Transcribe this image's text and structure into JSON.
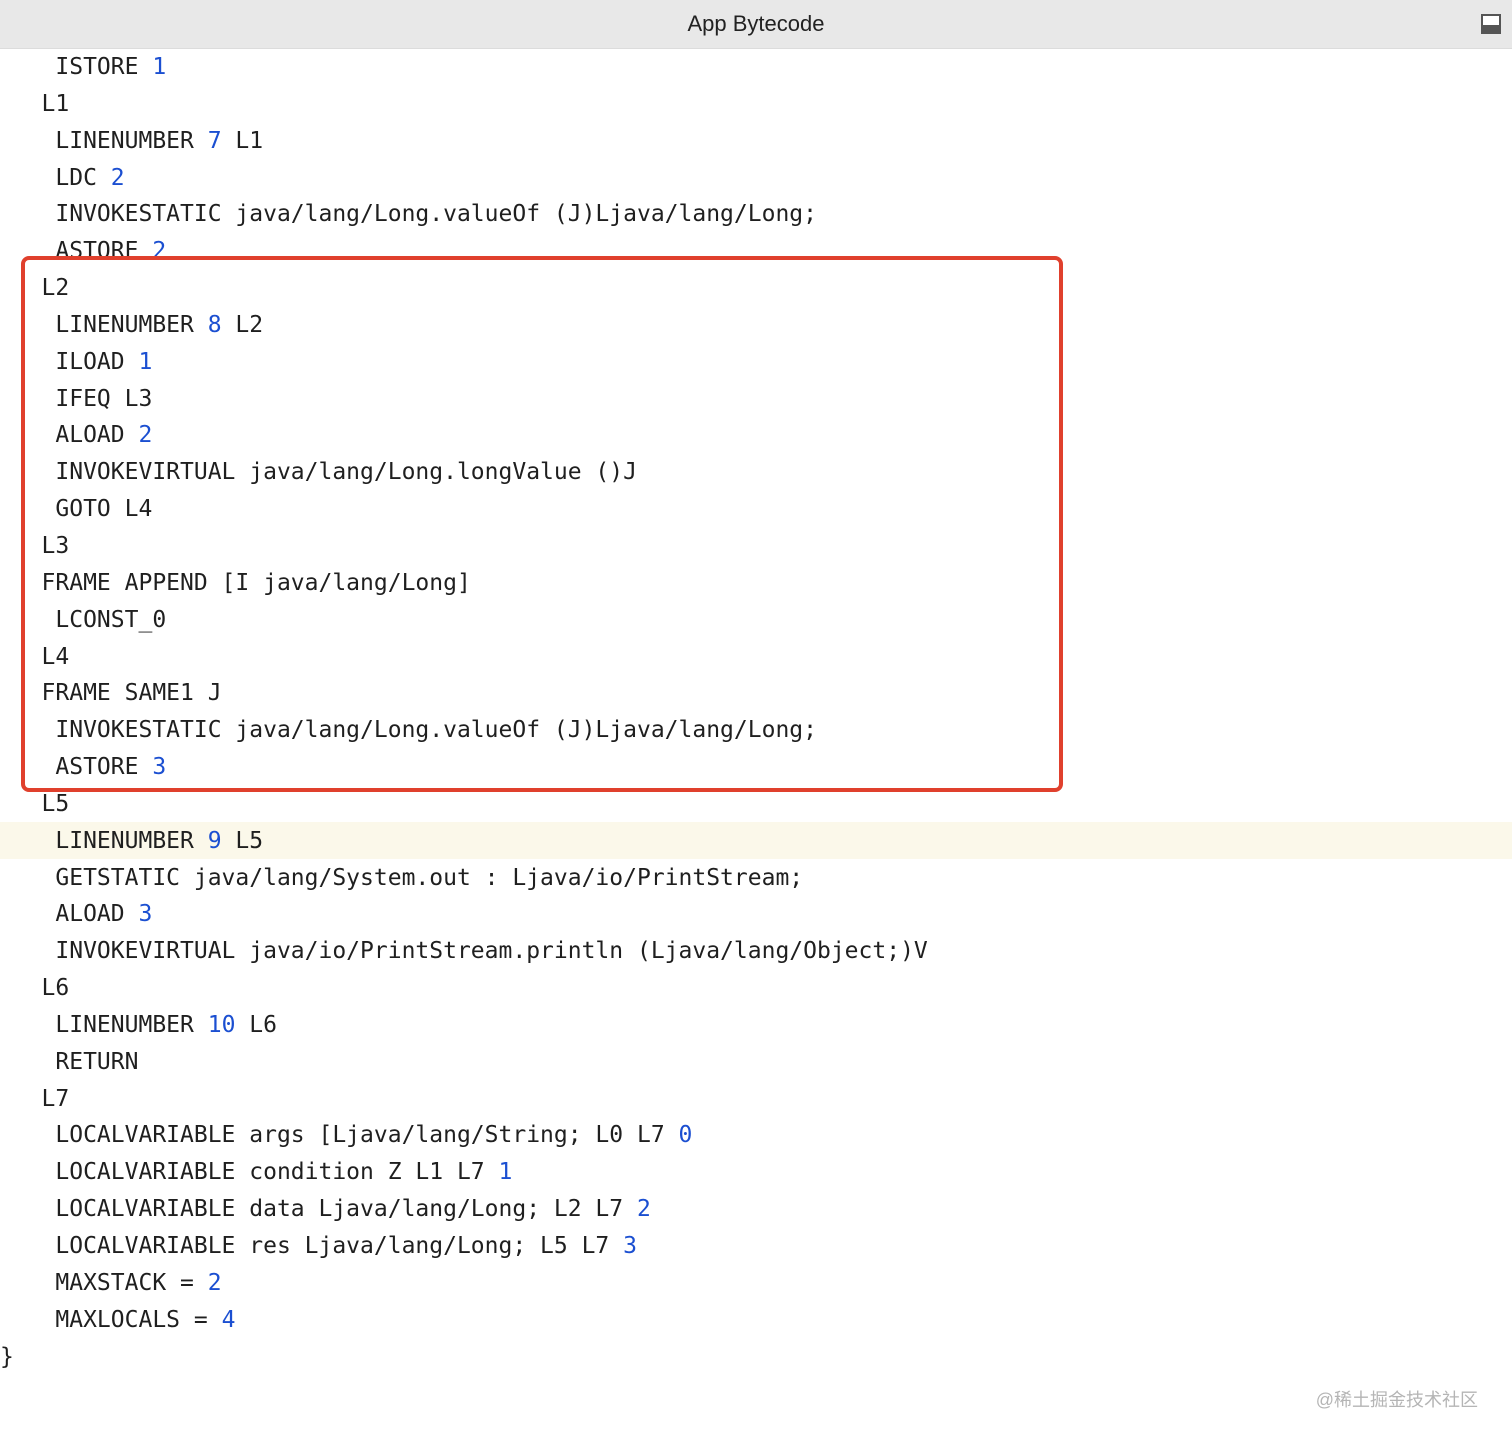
{
  "window": {
    "title": "App Bytecode"
  },
  "code_lines": [
    {
      "indent": 2,
      "parts": [
        {
          "t": "ISTORE "
        },
        {
          "t": "1",
          "n": 1
        }
      ]
    },
    {
      "indent": 1,
      "parts": [
        {
          "t": "L1"
        }
      ]
    },
    {
      "indent": 2,
      "parts": [
        {
          "t": "LINENUMBER "
        },
        {
          "t": "7",
          "n": 1
        },
        {
          "t": " L1"
        }
      ]
    },
    {
      "indent": 2,
      "parts": [
        {
          "t": "LDC "
        },
        {
          "t": "2",
          "n": 1
        }
      ]
    },
    {
      "indent": 2,
      "parts": [
        {
          "t": "INVOKESTATIC java/lang/Long.valueOf (J)Ljava/lang/Long;"
        }
      ]
    },
    {
      "indent": 2,
      "parts": [
        {
          "t": "ASTORE "
        },
        {
          "t": "2",
          "n": 1
        }
      ]
    },
    {
      "indent": 1,
      "parts": [
        {
          "t": "L2"
        }
      ]
    },
    {
      "indent": 2,
      "parts": [
        {
          "t": "LINENUMBER "
        },
        {
          "t": "8",
          "n": 1
        },
        {
          "t": " L2"
        }
      ]
    },
    {
      "indent": 2,
      "parts": [
        {
          "t": "ILOAD "
        },
        {
          "t": "1",
          "n": 1
        }
      ]
    },
    {
      "indent": 2,
      "parts": [
        {
          "t": "IFEQ L3"
        }
      ]
    },
    {
      "indent": 2,
      "parts": [
        {
          "t": "ALOAD "
        },
        {
          "t": "2",
          "n": 1
        }
      ]
    },
    {
      "indent": 2,
      "parts": [
        {
          "t": "INVOKEVIRTUAL java/lang/Long.longValue ()J"
        }
      ]
    },
    {
      "indent": 2,
      "parts": [
        {
          "t": "GOTO L4"
        }
      ]
    },
    {
      "indent": 1,
      "parts": [
        {
          "t": "L3"
        }
      ]
    },
    {
      "indent": 1,
      "parts": [
        {
          "t": "FRAME APPEND [I java/lang/Long]"
        }
      ]
    },
    {
      "indent": 2,
      "parts": [
        {
          "t": "LCONST_0"
        }
      ]
    },
    {
      "indent": 1,
      "parts": [
        {
          "t": "L4"
        }
      ]
    },
    {
      "indent": 1,
      "parts": [
        {
          "t": "FRAME SAME1 J"
        }
      ]
    },
    {
      "indent": 2,
      "parts": [
        {
          "t": "INVOKESTATIC java/lang/Long.valueOf (J)Ljava/lang/Long;"
        }
      ]
    },
    {
      "indent": 2,
      "parts": [
        {
          "t": "ASTORE "
        },
        {
          "t": "3",
          "n": 1
        }
      ]
    },
    {
      "indent": 1,
      "parts": [
        {
          "t": "L5"
        }
      ]
    },
    {
      "indent": 2,
      "hl": true,
      "parts": [
        {
          "t": "LINENUMBER "
        },
        {
          "t": "9",
          "n": 1
        },
        {
          "t": " L5"
        }
      ]
    },
    {
      "indent": 2,
      "parts": [
        {
          "t": "GETSTATIC java/lang/System.out : Ljava/io/PrintStream;"
        }
      ]
    },
    {
      "indent": 2,
      "parts": [
        {
          "t": "ALOAD "
        },
        {
          "t": "3",
          "n": 1
        }
      ]
    },
    {
      "indent": 2,
      "parts": [
        {
          "t": "INVOKEVIRTUAL java/io/PrintStream.println (Ljava/lang/Object;)V"
        }
      ]
    },
    {
      "indent": 1,
      "parts": [
        {
          "t": "L6"
        }
      ]
    },
    {
      "indent": 2,
      "parts": [
        {
          "t": "LINENUMBER "
        },
        {
          "t": "10",
          "n": 1
        },
        {
          "t": " L6"
        }
      ]
    },
    {
      "indent": 2,
      "parts": [
        {
          "t": "RETURN"
        }
      ]
    },
    {
      "indent": 1,
      "parts": [
        {
          "t": "L7"
        }
      ]
    },
    {
      "indent": 2,
      "parts": [
        {
          "t": "LOCALVARIABLE args [Ljava/lang/String; L0 L7 "
        },
        {
          "t": "0",
          "n": 1
        }
      ]
    },
    {
      "indent": 2,
      "parts": [
        {
          "t": "LOCALVARIABLE condition Z L1 L7 "
        },
        {
          "t": "1",
          "n": 1
        }
      ]
    },
    {
      "indent": 2,
      "parts": [
        {
          "t": "LOCALVARIABLE data Ljava/lang/Long; L2 L7 "
        },
        {
          "t": "2",
          "n": 1
        }
      ]
    },
    {
      "indent": 2,
      "parts": [
        {
          "t": "LOCALVARIABLE res Ljava/lang/Long; L5 L7 "
        },
        {
          "t": "3",
          "n": 1
        }
      ]
    },
    {
      "indent": 2,
      "parts": [
        {
          "t": "MAXSTACK = "
        },
        {
          "t": "2",
          "n": 1
        }
      ]
    },
    {
      "indent": 2,
      "parts": [
        {
          "t": "MAXLOCALS = "
        },
        {
          "t": "4",
          "n": 1
        }
      ]
    },
    {
      "indent": 0,
      "parts": [
        {
          "t": "}"
        }
      ]
    }
  ],
  "watermark": "@稀土掘金技术社区",
  "colors": {
    "number": "#1b4fd1",
    "highlight_box": "#e0402d",
    "current_line": "#fbf8ea"
  }
}
